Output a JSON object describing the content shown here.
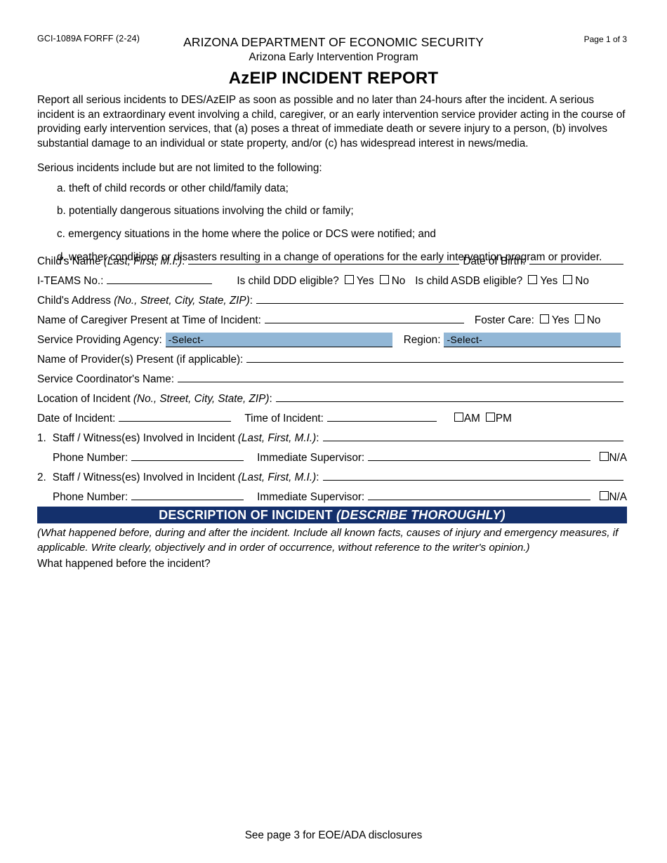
{
  "header": {
    "form_number": "GCI-1089A FORFF (2-24)",
    "page_indicator": "Page 1 of 3",
    "agency_line1": "ARIZONA DEPARTMENT OF ECONOMIC SECURITY",
    "agency_line2": "Arizona Early Intervention Program",
    "document_title": "AzEIP INCIDENT REPORT"
  },
  "intro": {
    "paragraph": "Report all serious incidents to DES/AzEIP as soon as possible and no later than 24-hours after the incident. A serious incident is an extraordinary event involving a child, caregiver, or an early intervention service provider acting in the course of providing early intervention services, that (a) poses a threat of immediate death or severe injury to a person, (b) involves substantial damage to an individual or state property, and/or (c) has widespread interest in news/media.",
    "lead_in": "Serious incidents include but are not limited to the following:",
    "bullets": [
      "a. theft of child records or other child/family data;",
      "b. potentially dangerous situations involving the child or family;",
      "c. emergency situations in the home where the police or DCS were notified; and",
      "d. weather conditions or disasters resulting in a change of operations for the early intervention program or provider."
    ]
  },
  "fields": {
    "child_name_label": "Child's Name",
    "child_name_hint": "(Last, First, M.I.)",
    "child_name_value": "",
    "date_of_birth_label": "Date of Birth:",
    "date_of_birth_value": "",
    "iteams_label": "I-TEAMS No.:",
    "iteams_value": "",
    "ddd_question": "Is child DDD eligible?",
    "asdb_question": "Is child ASDB eligible?",
    "yes_label": "Yes",
    "no_label": "No",
    "child_address_label": "Child's Address",
    "child_address_hint": "(No., Street, City, State, ZIP)",
    "child_address_value": "",
    "caregiver_label": "Name of Caregiver Present at Time of Incident:",
    "caregiver_value": "",
    "foster_care_label": "Foster Care:",
    "service_agency_label": "Service Providing Agency:",
    "service_agency_value": "-Select-",
    "region_label": "Region:",
    "region_value": "-Select-",
    "providers_label": "Name of Provider(s) Present (if applicable):",
    "providers_value": "",
    "coordinator_label": "Service Coordinator's Name:",
    "coordinator_value": "",
    "location_label": "Location of Incident",
    "location_hint": "(No., Street, City, State, ZIP)",
    "location_value": "",
    "date_incident_label": "Date of Incident:",
    "date_incident_value": "",
    "time_incident_label": "Time of Incident:",
    "time_incident_value": "",
    "am_label": "AM",
    "pm_label": "PM",
    "staff1_number": "1.",
    "staff1_label": "Staff / Witness(es) Involved in Incident",
    "staff1_hint": "(Last, First, M.I.)",
    "staff1_value": "",
    "staff2_number": "2.",
    "staff2_label": "Staff / Witness(es) Involved in Incident",
    "staff2_hint": "(Last, First, M.I.)",
    "staff2_value": "",
    "phone_label": "Phone Number:",
    "phone1_value": "",
    "phone2_value": "",
    "supervisor_label": "Immediate Supervisor:",
    "supervisor1_value": "",
    "supervisor2_value": "",
    "na_label": "N/A"
  },
  "description_section": {
    "banner_main": "DESCRIPTION OF INCIDENT ",
    "banner_italic": "(DESCRIBE THOROUGHLY)",
    "note": "(What happened before, during and after the incident. Include all known facts, causes of injury and emergency measures, if applicable. Write clearly, objectively and in order of occurrence, without reference to the writer's opinion.)",
    "question": "What happened before the incident?",
    "answer_value": ""
  },
  "footer": {
    "text": "See page 3 for EOE/ADA disclosures"
  },
  "colors": {
    "banner_navy": "#14306c",
    "select_blue": "#92b7d6",
    "rule_black": "#000000"
  }
}
